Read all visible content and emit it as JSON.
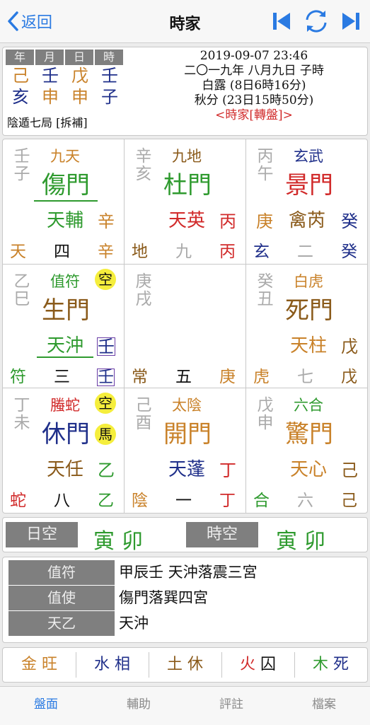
{
  "nav": {
    "back_label": "返回",
    "title": "時家"
  },
  "header": {
    "pillar_headers": [
      "年",
      "月",
      "日",
      "時"
    ],
    "stems": [
      "己",
      "壬",
      "戊",
      "壬"
    ],
    "branches": [
      "亥",
      "申",
      "申",
      "子"
    ],
    "ju": "陰遁七局 [拆補]",
    "date": "2019-09-07 23:46",
    "lunar": "二〇一九年 八月九日 子時",
    "term1": "白露 (8日6時16分)",
    "term2": "秋分 (23日15時50分)",
    "mode": "<時家[轉盤]>"
  },
  "palaces": [
    {
      "cs": "壬子",
      "god": "九天",
      "door": "傷門",
      "star": "天輔",
      "heaven": "辛",
      "b1": "天",
      "b2": "四",
      "b3": "辛"
    },
    {
      "cs": "辛亥",
      "god": "九地",
      "door": "杜門",
      "star": "天英",
      "heaven": "丙",
      "b1": "地",
      "b2": "九",
      "b3": "丙"
    },
    {
      "cs": "丙午",
      "god": "玄武",
      "door": "景門",
      "star": "禽芮",
      "heaven": "癸",
      "heaven2": "庚",
      "b1": "玄",
      "b2": "二",
      "b3": "癸"
    },
    {
      "cs": "乙巳",
      "god": "值符",
      "door": "生門",
      "star": "天沖",
      "heaven": "壬",
      "badge": "空",
      "b1": "符",
      "b2": "三",
      "b3": "壬"
    },
    {
      "cs": "庚戌",
      "b1": "常",
      "b2": "五",
      "b3": "庚"
    },
    {
      "cs": "癸丑",
      "god": "白虎",
      "door": "死門",
      "star": "天柱",
      "heaven": "戊",
      "b1": "虎",
      "b2": "七",
      "b3": "戊"
    },
    {
      "cs": "丁未",
      "god": "螣蛇",
      "door": "休門",
      "star": "天任",
      "heaven": "乙",
      "badge": "空",
      "badge2": "馬",
      "b1": "蛇",
      "b2": "八",
      "b3": "乙"
    },
    {
      "cs": "己酉",
      "god": "太陰",
      "door": "開門",
      "star": "天蓬",
      "heaven": "丁",
      "b1": "陰",
      "b2": "一",
      "b3": "丁"
    },
    {
      "cs": "戊申",
      "god": "六合",
      "door": "驚門",
      "star": "天心",
      "heaven": "己",
      "b1": "合",
      "b2": "六",
      "b3": "己"
    }
  ],
  "void": {
    "day_label": "日空",
    "day_value": "寅卯",
    "hour_label": "時空",
    "hour_value": "寅卯"
  },
  "info": [
    {
      "label": "值符",
      "value": "甲辰壬  天沖落震三宮"
    },
    {
      "label": "值使",
      "value": "傷門落巽四宮"
    },
    {
      "label": "天乙",
      "value": "天沖"
    }
  ],
  "phases": [
    {
      "element": "金",
      "state": "旺"
    },
    {
      "element": "水",
      "state": "相"
    },
    {
      "element": "土",
      "state": "休"
    },
    {
      "element": "火",
      "state": "囚"
    },
    {
      "element": "木",
      "state": "死"
    }
  ],
  "tabs": [
    "盤面",
    "輔助",
    "評註",
    "檔案"
  ],
  "colors": {
    "accent": "#2a7ae2",
    "wood": "#2e9a2e",
    "fire": "#d12a2a",
    "earth": "#c9822a",
    "water": "#1f2f8a",
    "metal": "#c9822a"
  }
}
